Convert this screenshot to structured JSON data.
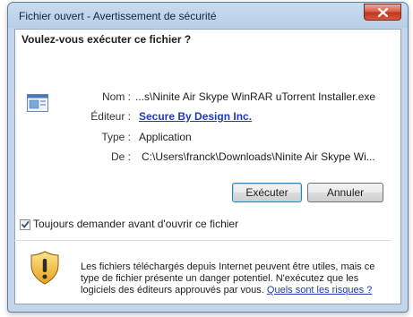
{
  "window": {
    "title": "Fichier ouvert - Avertissement de sécurité",
    "close_icon": "close-x-icon"
  },
  "dialog": {
    "question": "Voulez-vous exécuter ce fichier ?",
    "file_icon": "application-file-icon",
    "fields": [
      {
        "label": "Nom :",
        "value": "...s\\Ninite Air Skype WinRAR uTorrent Installer.exe"
      },
      {
        "label": "Éditeur :",
        "value": "Secure By Design Inc."
      },
      {
        "label": "Type :",
        "value": "Application"
      },
      {
        "label": "De :",
        "value": "C:\\Users\\franck\\Downloads\\Ninite Air Skype Wi..."
      }
    ],
    "buttons": {
      "run": "Exécuter",
      "cancel": "Annuler"
    },
    "checkbox": {
      "label": "Toujours demander avant d'ouvrir ce fichier",
      "checked": true
    },
    "warning": {
      "icon": "security-shield-icon",
      "text": "Les fichiers téléchargés depuis Internet peuvent être utiles, mais ce type de fichier présente un danger potentiel. N'exécutez que les logiciels des éditeurs approuvés par vous.",
      "link": "Quels sont les risques ?"
    }
  },
  "colors": {
    "link": "#1f3bb5",
    "frame": "#b8cfe8",
    "close_button": "#c5331c"
  }
}
